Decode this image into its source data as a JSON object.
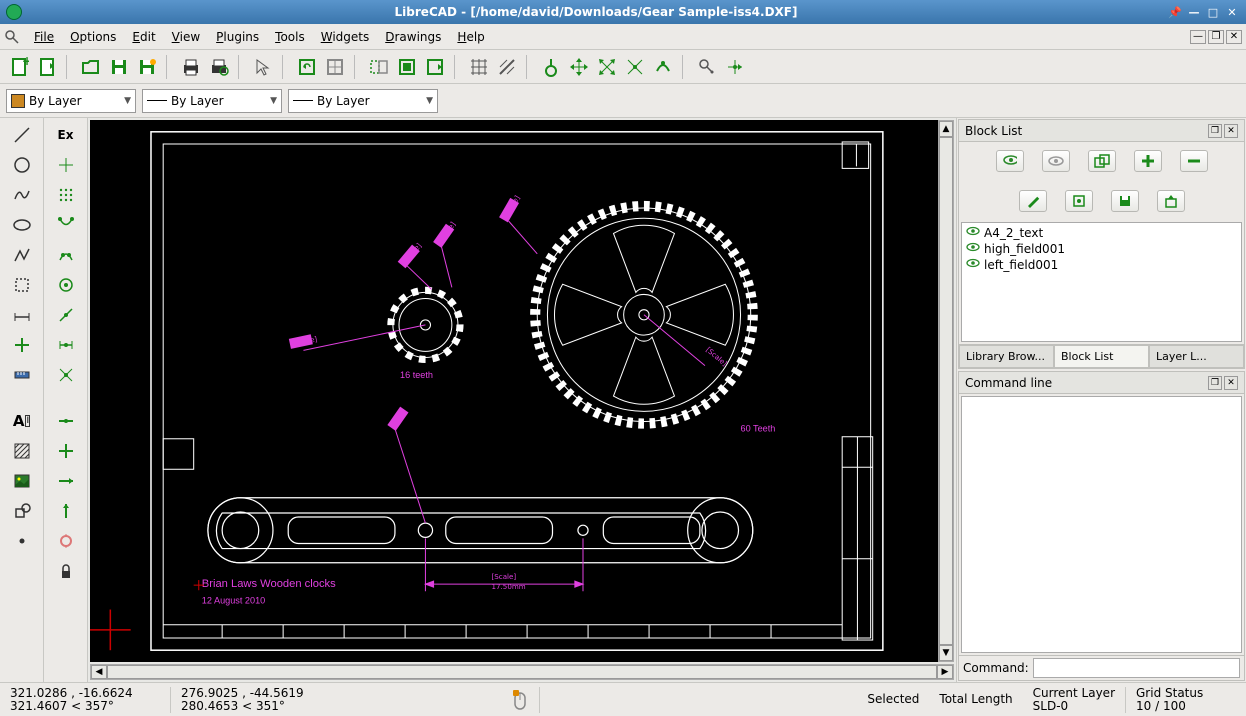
{
  "title": "LibreCAD - [/home/david/Downloads/Gear Sample-iss4.DXF]",
  "menu": {
    "file": "File",
    "options": "Options",
    "edit": "Edit",
    "view": "View",
    "plugins": "Plugins",
    "tools": "Tools",
    "widgets": "Widgets",
    "drawings": "Drawings",
    "help": "Help"
  },
  "combos": {
    "color": "By Layer",
    "width": "By Layer",
    "ltype": "By Layer"
  },
  "snap_label": "Ex",
  "blocklist": {
    "title": "Block List",
    "items": [
      "A4_2_text",
      "high_field001",
      "left_field001"
    ],
    "tabs": {
      "lib": "Library Brow...",
      "blk": "Block List",
      "lay": "Layer L..."
    }
  },
  "cmdline": {
    "title": "Command line",
    "prompt": "Command:"
  },
  "status": {
    "abs1": "321.0286 , -16.6624",
    "abs2": "321.4607 < 357°",
    "rel1": "276.9025 , -44.5619",
    "rel2": "280.4653 < 351°",
    "sel": "Selected",
    "tlen": "Total Length",
    "clay": "Current Layer",
    "sld": "SLD-0",
    "grid": "Grid Status",
    "gridv": "10 / 100"
  },
  "drawing": {
    "small_gear_label": "16 teeth",
    "large_gear_label": "60 Teeth",
    "author": "Brian Laws Wooden clocks",
    "date": "12 August 2010",
    "dim1": "[Scale]",
    "dim1b": "8.50mm",
    "dim2": "[Scale]",
    "dim2b": "8.10mm",
    "dim3": "[Scale]",
    "dim3b": "4.50mm",
    "dim4": "[Scale]",
    "dim4b": "12.30mm",
    "dim5": "[Scale]",
    "dim5b": "17.50mm"
  }
}
